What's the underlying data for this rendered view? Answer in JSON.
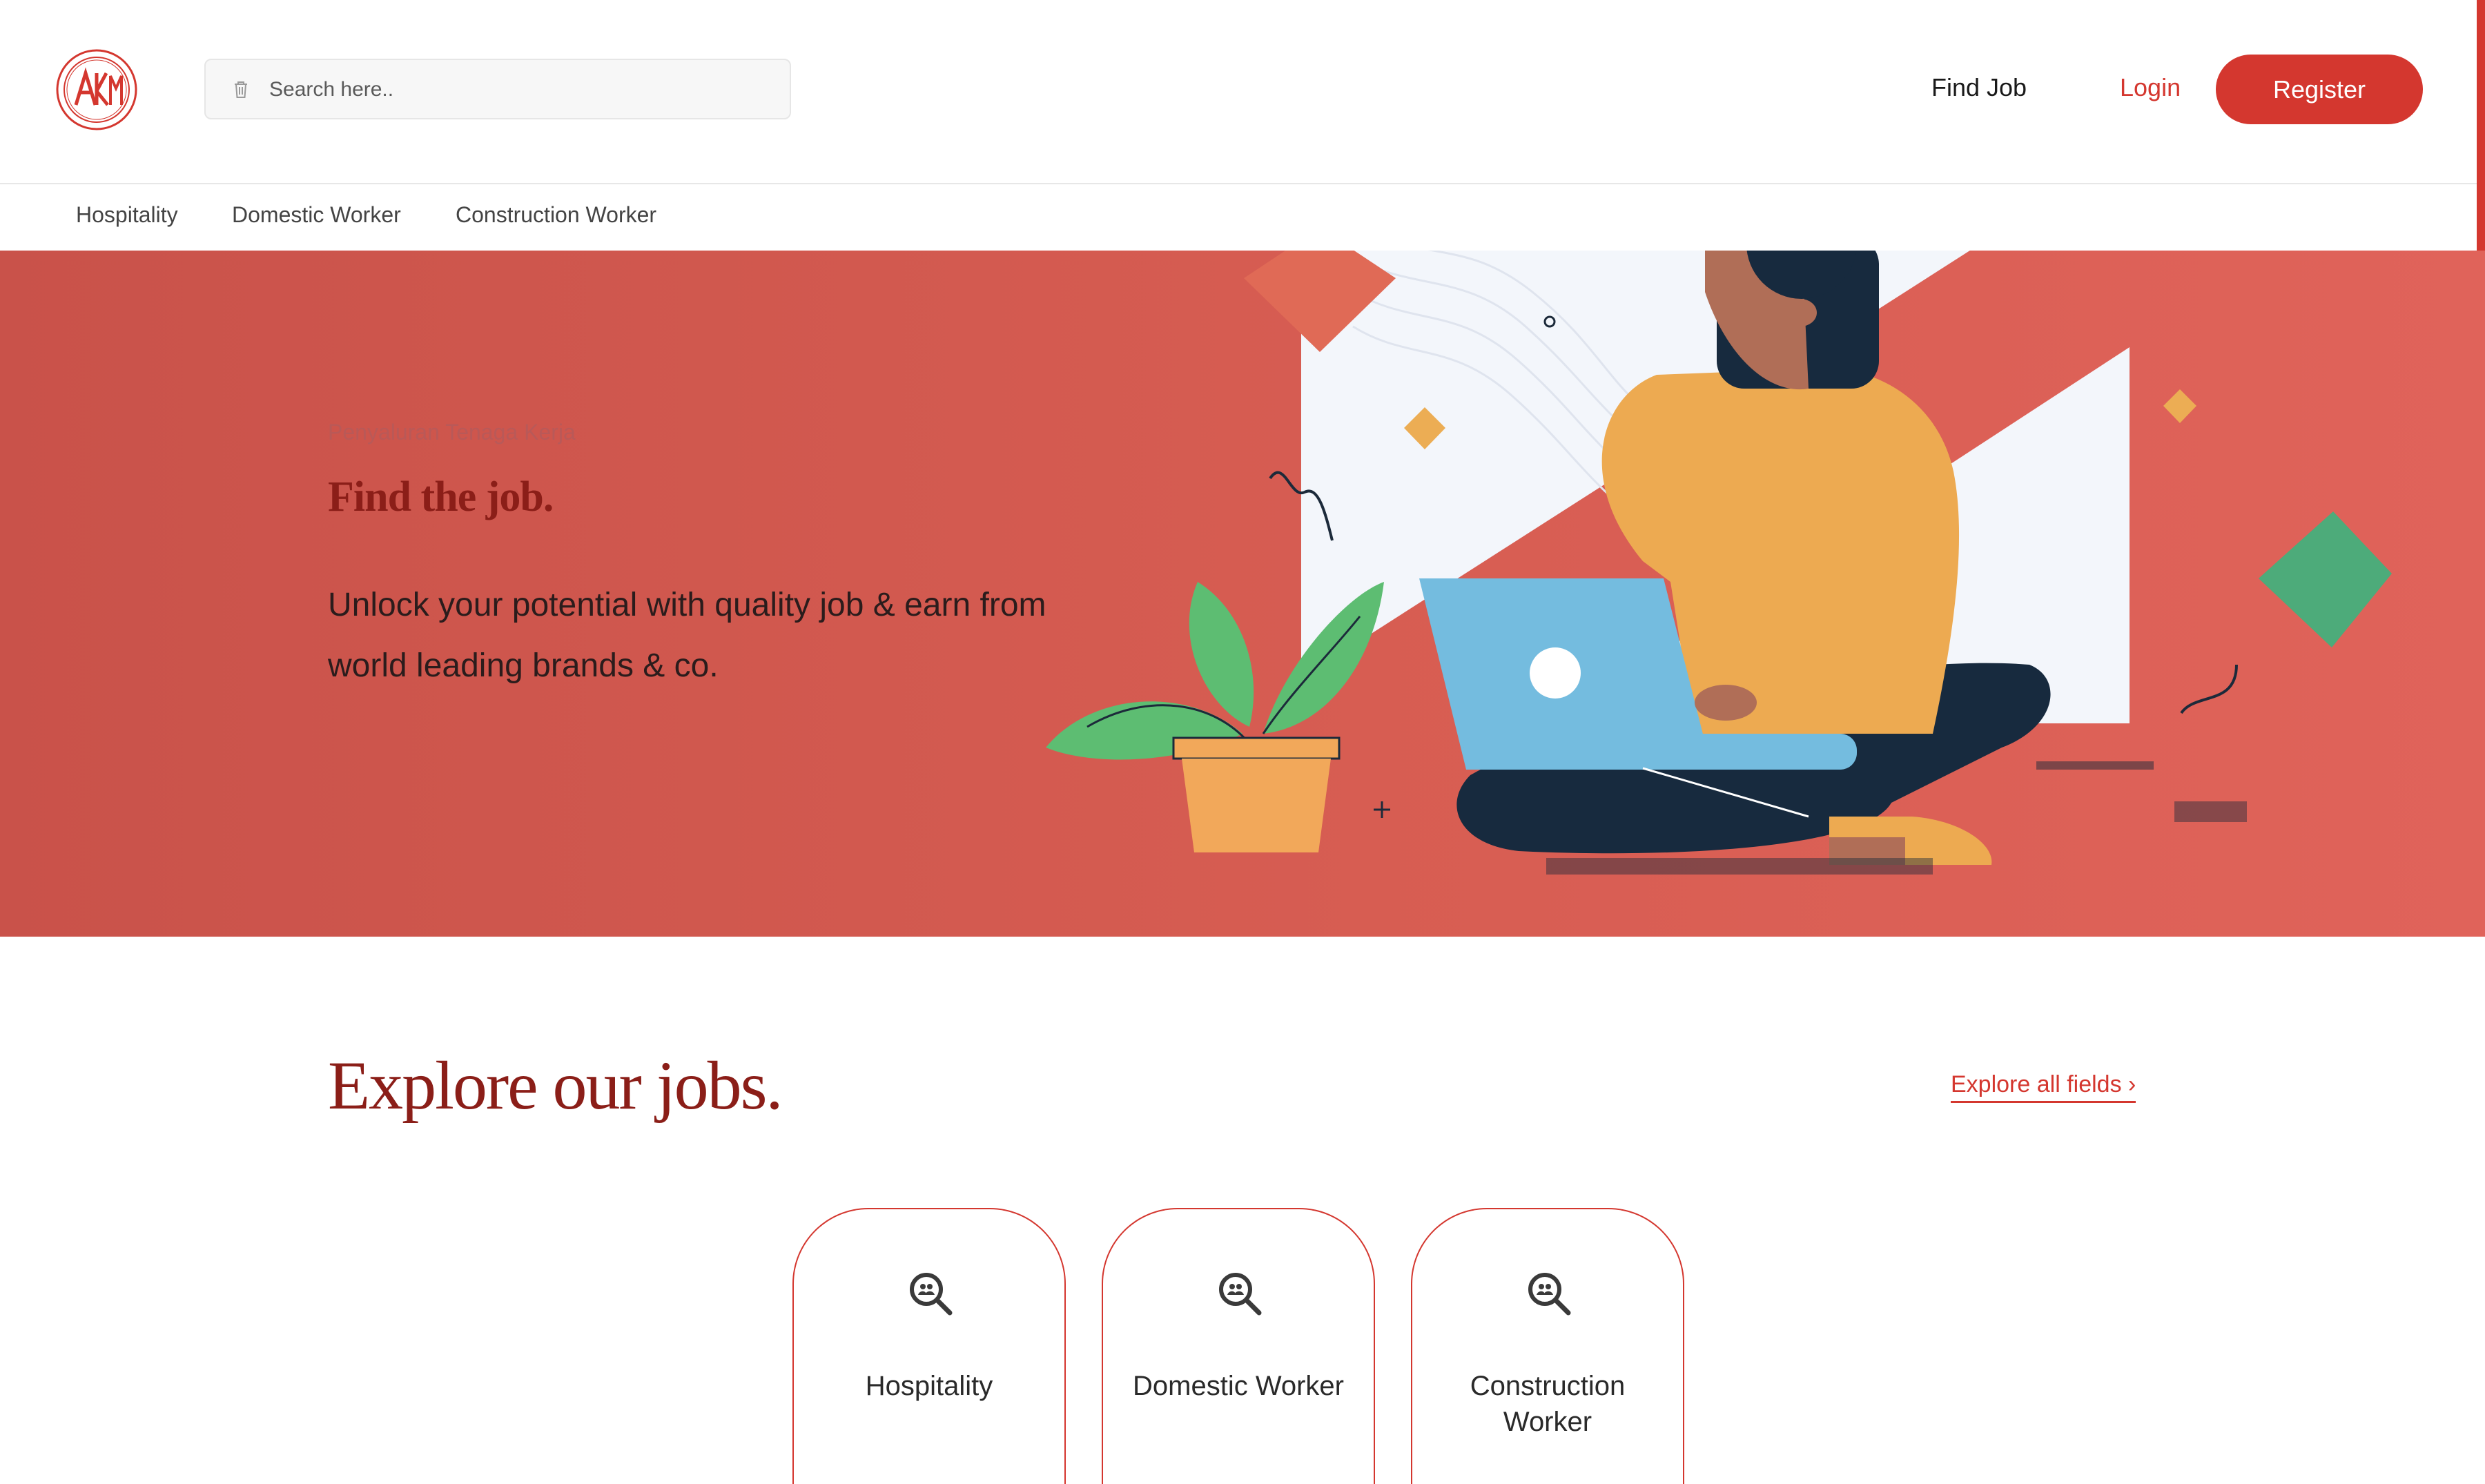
{
  "header": {
    "logo_alt": "AKM",
    "search_placeholder": "Search here..",
    "nav": {
      "find_job": "Find Job",
      "login": "Login",
      "register": "Register"
    }
  },
  "subnav": {
    "items": [
      "Hospitality",
      "Domestic Worker",
      "Construction Worker"
    ]
  },
  "hero": {
    "eyebrow": "Penyaluran Tenaga Kerja",
    "title": "Find the job.",
    "subtitle": "Unlock your potential with quality job & earn from world leading brands & co."
  },
  "explore": {
    "title": "Explore our jobs.",
    "link": "Explore all fields ›",
    "cards": [
      {
        "label": "Hospitality",
        "icon": "search-people-icon"
      },
      {
        "label": "Domestic Worker",
        "icon": "search-people-icon"
      },
      {
        "label": "Construction Worker",
        "icon": "search-people-icon"
      }
    ]
  },
  "colors": {
    "brand": "#d4372f",
    "hero_bg": "#d75d52",
    "heading": "#8b1e18"
  }
}
